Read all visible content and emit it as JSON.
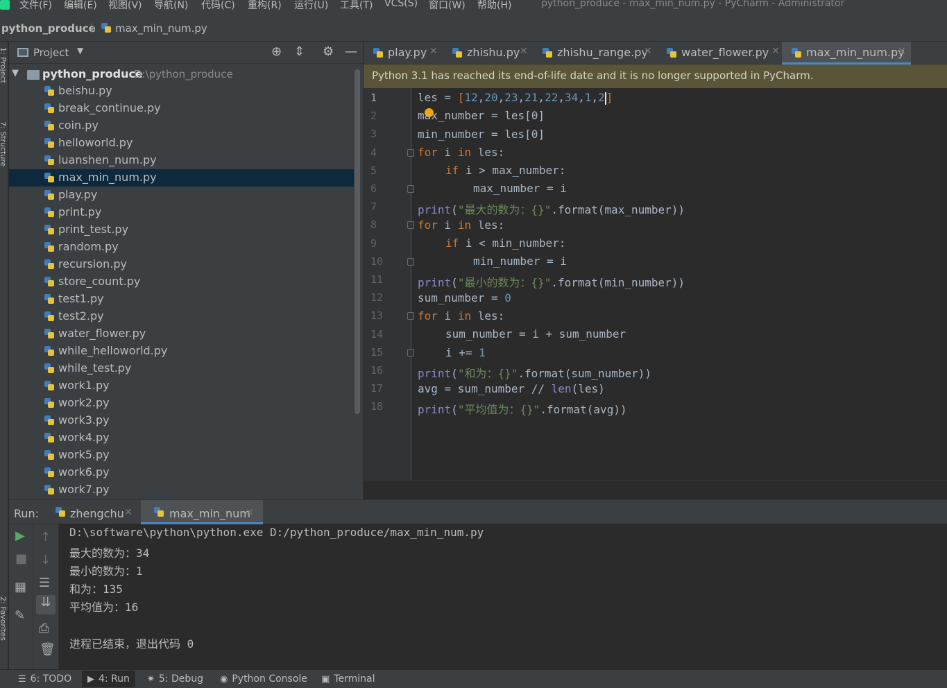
{
  "menu": {
    "items": [
      "文件(F)",
      "编辑(E)",
      "视图(V)",
      "导航(N)",
      "代码(C)",
      "重构(R)",
      "运行(U)",
      "工具(T)",
      "VCS(S)",
      "窗口(W)",
      "帮助(H)"
    ],
    "window_title": "python_produce - max_min_num.py - PyCharm - Administrator"
  },
  "breadcrumb": {
    "project": "python_produce",
    "file": "max_min_num.py"
  },
  "left_strip": {
    "project_label": "1: Project",
    "structure_label": "7: Structure",
    "favorites_label": "2: Favorites"
  },
  "project_panel": {
    "title": "Project",
    "root_name": "python_produce",
    "root_path": "D:\\python_produce",
    "selected_file": "max_min_num.py",
    "files": [
      "beishu.py",
      "break_continue.py",
      "coin.py",
      "helloworld.py",
      "luanshen_num.py",
      "max_min_num.py",
      "play.py",
      "print.py",
      "print_test.py",
      "random.py",
      "recursion.py",
      "store_count.py",
      "test1.py",
      "test2.py",
      "water_flower.py",
      "while_helloworld.py",
      "while_test.py",
      "work1.py",
      "work2.py",
      "work3.py",
      "work4.py",
      "work5.py",
      "work6.py",
      "work7.py"
    ]
  },
  "editor_tabs": [
    {
      "label": "play.py",
      "active": false
    },
    {
      "label": "zhishu.py",
      "active": false
    },
    {
      "label": "zhishu_range.py",
      "active": false
    },
    {
      "label": "water_flower.py",
      "active": false
    },
    {
      "label": "max_min_num.py",
      "active": true
    }
  ],
  "banner": "Python 3.1 has reached its end-of-life date and it is no longer supported in PyCharm.",
  "line_numbers": [
    "1",
    "2",
    "3",
    "4",
    "5",
    "6",
    "7",
    "8",
    "9",
    "10",
    "11",
    "12",
    "13",
    "14",
    "15",
    "16",
    "17",
    "18"
  ],
  "code": {
    "l1": {
      "a": "les = ",
      "b": "[",
      "n1": "12",
      "n2": "20",
      "n3": "23",
      "n4": "21",
      "n5": "22",
      "n6": "34",
      "n7": "1",
      "n8": "2",
      "c": "]"
    },
    "l2": "max_number = les[0]",
    "l3": "min_number = les[0]",
    "l4": {
      "k": "for",
      "a": " i ",
      "k2": "in",
      "b": " les:"
    },
    "l5": {
      "k": "if",
      "a": " i > max_number:"
    },
    "l6": "max_number = i",
    "l7": {
      "f": "print",
      "a": "(",
      "s": "\"最大的数为：{}\"",
      "b": ".format(max_number))"
    },
    "l8": {
      "k": "for",
      "a": " i ",
      "k2": "in",
      "b": " les:"
    },
    "l9": {
      "k": "if",
      "a": " i < min_number:"
    },
    "l10": "min_number = i",
    "l11": {
      "f": "print",
      "a": "(",
      "s": "\"最小的数为：{}\"",
      "b": ".format(min_number))"
    },
    "l12": {
      "a": "sum_number = ",
      "n": "0"
    },
    "l13": {
      "k": "for",
      "a": " i ",
      "k2": "in",
      "b": " les:"
    },
    "l14": "sum_number = i + sum_number",
    "l15": {
      "a": "i += ",
      "n": "1"
    },
    "l16": {
      "f": "print",
      "a": "(",
      "s": "\"和为：{}\"",
      "b": ".format(sum_number))"
    },
    "l17": {
      "a": "avg = sum_number // ",
      "f": "len",
      "b": "(les)"
    },
    "l18": {
      "f": "print",
      "a": "(",
      "s": "\"平均值为：{}\"",
      "b": ".format(avg))"
    }
  },
  "run_panel": {
    "label": "Run:",
    "tabs": [
      {
        "label": "zhengchu",
        "active": false
      },
      {
        "label": "max_min_num",
        "active": true
      }
    ],
    "console_lines": [
      "D:\\software\\python\\python.exe D:/python_produce/max_min_num.py",
      "最大的数为：34",
      "最小的数为：1",
      "和为：135",
      "平均值为：16",
      "",
      "进程已结束，退出代码 0"
    ]
  },
  "status_bar": {
    "todo": "6: TODO",
    "run": "4: Run",
    "debug": "5: Debug",
    "python_console": "Python Console",
    "terminal": "Terminal"
  },
  "colors": {
    "accent": "#4a88c7",
    "keyword": "#cc7832",
    "number": "#6897bb",
    "string": "#6a8759",
    "builtin": "#8888c6",
    "selection": "#0d293e"
  }
}
